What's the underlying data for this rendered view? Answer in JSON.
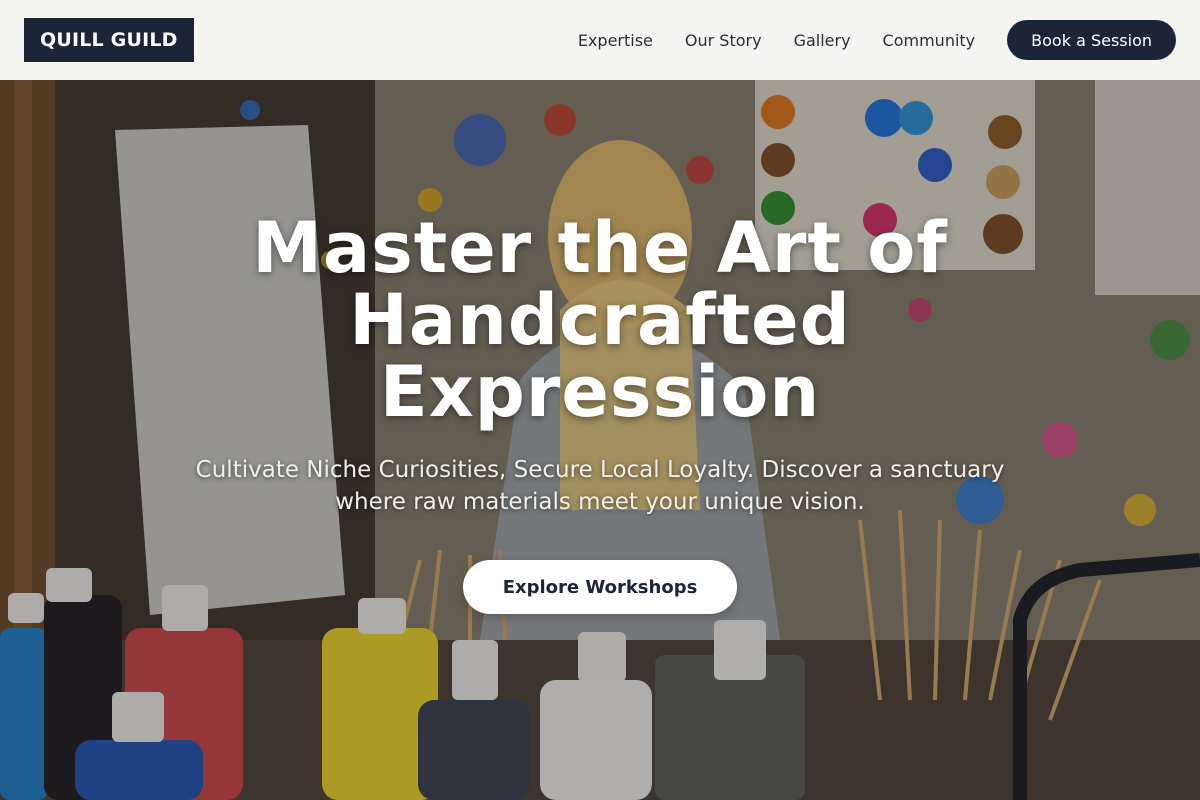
{
  "header": {
    "logo": "QUILL GUILD",
    "nav": [
      {
        "label": "Expertise"
      },
      {
        "label": "Our Story"
      },
      {
        "label": "Gallery"
      },
      {
        "label": "Community"
      }
    ],
    "cta_label": "Book a Session"
  },
  "hero": {
    "headline": "Master the Art of Handcrafted Expression",
    "subhead": "Cultivate Niche Curiosities, Secure Local Loyalty. Discover a sanctuary where raw materials meet your unique vision.",
    "button_label": "Explore Workshops",
    "background_image": "art-studio-paint-bottles-photo"
  },
  "colors": {
    "brand_navy": "#1c2438",
    "header_bg": "#f4f4f3",
    "white": "#ffffff"
  }
}
